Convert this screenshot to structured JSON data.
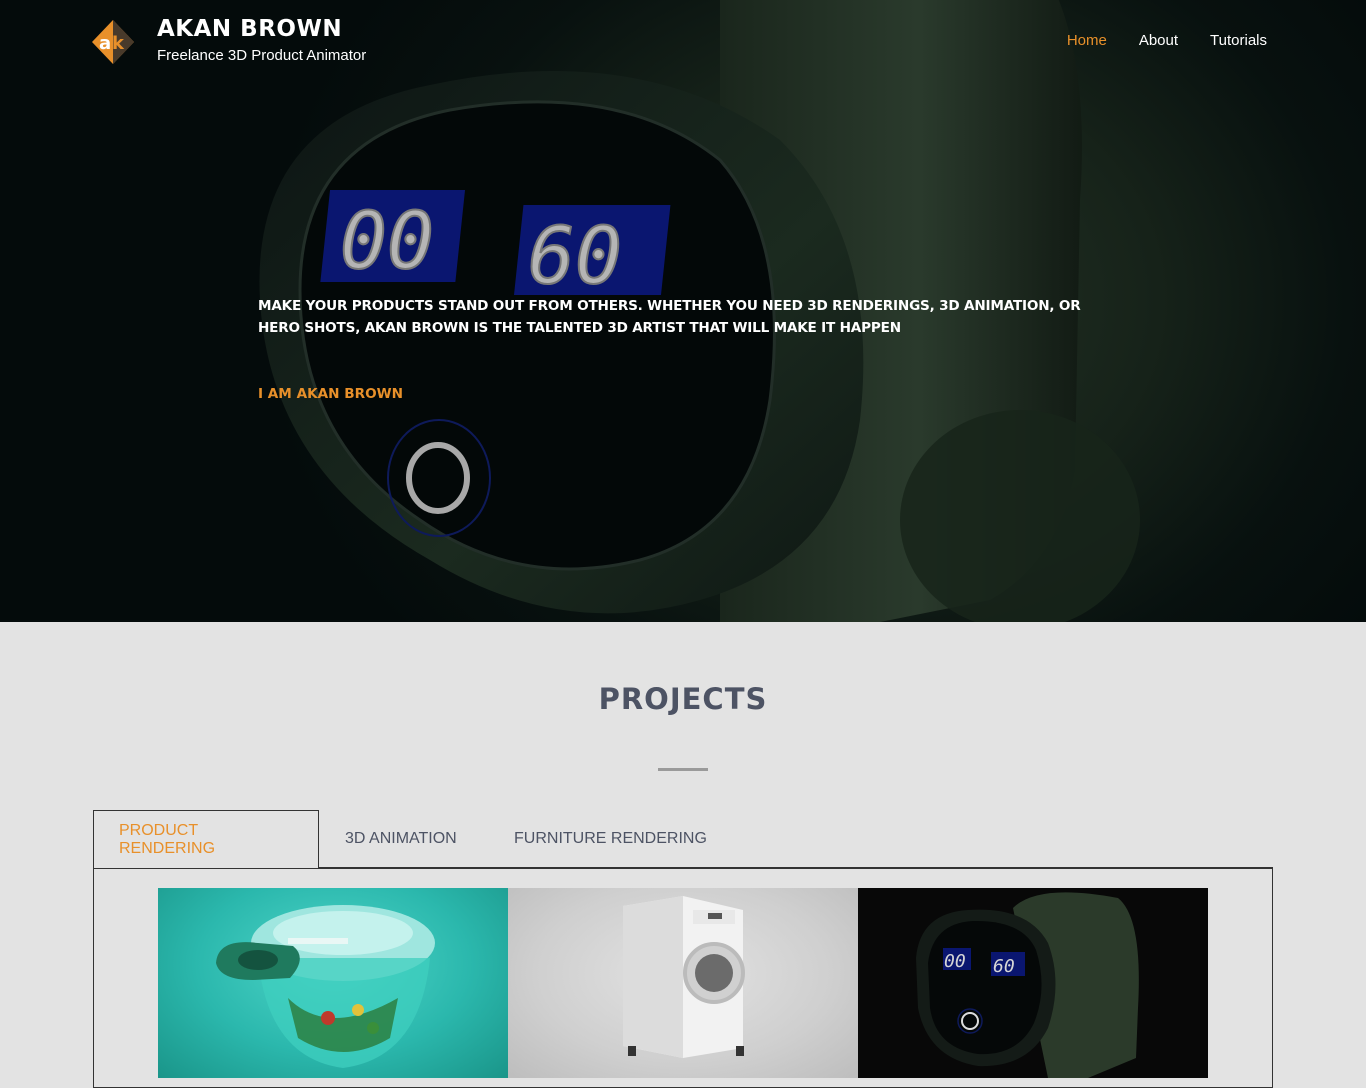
{
  "header": {
    "logo_icon": "ak-logo-icon",
    "name": "AKAN BROWN",
    "tagline": "Freelance 3D Product Animator"
  },
  "nav": {
    "items": [
      {
        "label": "Home",
        "active": true
      },
      {
        "label": "About",
        "active": false
      },
      {
        "label": "Tutorials",
        "active": false
      }
    ]
  },
  "hero": {
    "headline": "MAKE YOUR PRODUCTS STAND OUT FROM OTHERS. WHETHER YOU NEED 3D RENDERINGS, 3D ANIMATION, OR HERO SHOTS, AKAN BROWN IS THE TALENTED 3D ARTIST THAT WILL MAKE IT HAPPEN",
    "cta": "I AM AKAN BROWN",
    "display_left": "00",
    "display_right": "60"
  },
  "projects": {
    "title": "PROJECTS",
    "tabs": [
      {
        "label": "PRODUCT RENDERING",
        "active": true
      },
      {
        "label": "3D ANIMATION",
        "active": false
      },
      {
        "label": "FURNITURE RENDERING",
        "active": false
      }
    ],
    "thumbs": [
      {
        "subject": "food-chopper-render"
      },
      {
        "subject": "washing-machine-render"
      },
      {
        "subject": "massage-gun-render",
        "display_left": "00",
        "display_right": "60"
      }
    ]
  },
  "colors": {
    "accent": "#e8902a",
    "heading": "#4d5364",
    "section_bg": "#e3e3e3"
  }
}
